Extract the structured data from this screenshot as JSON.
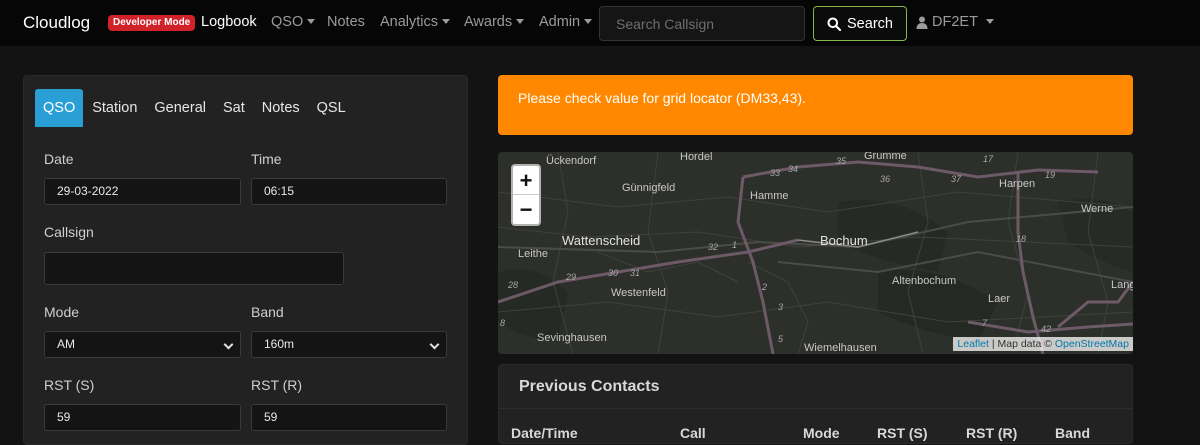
{
  "nav": {
    "brand": "Cloudlog",
    "badge": "Developer Mode",
    "items": [
      {
        "label": "Logbook",
        "dropdown": false
      },
      {
        "label": "QSO",
        "dropdown": true
      },
      {
        "label": "Notes",
        "dropdown": false
      },
      {
        "label": "Analytics",
        "dropdown": true
      },
      {
        "label": "Awards",
        "dropdown": true
      },
      {
        "label": "Admin",
        "dropdown": true
      }
    ],
    "search_placeholder": "Search Callsign",
    "search_button": "Search",
    "user": "DF2ET"
  },
  "qso_form": {
    "tabs": [
      "QSO",
      "Station",
      "General",
      "Sat",
      "Notes",
      "QSL"
    ],
    "active_tab": "QSO",
    "date_label": "Date",
    "date_value": "29-03-2022",
    "time_label": "Time",
    "time_value": "06:15",
    "callsign_label": "Callsign",
    "callsign_value": "",
    "mode_label": "Mode",
    "mode_value": "AM",
    "band_label": "Band",
    "band_value": "160m",
    "rst_s_label": "RST (S)",
    "rst_s_value": "59",
    "rst_r_label": "RST (R)",
    "rst_r_value": "59"
  },
  "alert": {
    "message": "Please check value for grid locator (DM33,43).",
    "color": "#ff8800"
  },
  "map": {
    "zoom_in": "+",
    "zoom_out": "−",
    "attribution_leaflet": "Leaflet",
    "attribution_sep": " | Map data © ",
    "attribution_osm": "OpenStreetMap",
    "places": [
      "Ückendorf",
      "Hordel",
      "Grumme",
      "Günnigfeld",
      "Hamme",
      "Harpen",
      "Werne",
      "Wattenscheid",
      "Bochum",
      "Leithe",
      "Westenfeld",
      "Altenbochum",
      "Laer",
      "Lang",
      "Sevinghausen",
      "Wiemelhausen"
    ],
    "road_numbers": [
      "17",
      "19",
      "33",
      "34",
      "35",
      "36",
      "37",
      "32",
      "1",
      "2",
      "3",
      "5",
      "7",
      "18",
      "28",
      "29",
      "30",
      "31",
      "42",
      "8"
    ]
  },
  "contacts": {
    "title": "Previous Contacts",
    "columns": [
      "Date/Time",
      "Call",
      "Mode",
      "RST (S)",
      "RST (R)",
      "Band"
    ]
  },
  "colors": {
    "accent_tab": "#2a9fd6",
    "search_border": "#86b848",
    "badge": "#d02228"
  }
}
